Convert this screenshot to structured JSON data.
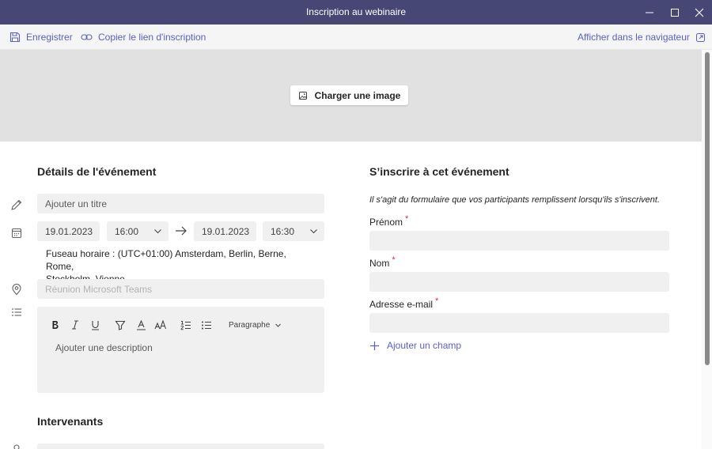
{
  "window": {
    "title": "Inscription au webinaire"
  },
  "toolbar": {
    "save_label": "Enregistrer",
    "copy_link_label": "Copier le lien d'inscription",
    "open_browser_label": "Afficher dans le navigateur"
  },
  "banner": {
    "upload_label": "Charger une image"
  },
  "details": {
    "heading": "Détails de l'événement",
    "title_placeholder": "Ajouter un titre",
    "start_date": "19.01.2023",
    "start_time": "16:00",
    "end_date": "19.01.2023",
    "end_time": "16:30",
    "timezone_line1": "Fuseau horaire : (UTC+01:00) Amsterdam, Berlin, Berne, Rome,",
    "timezone_line2": "Stockholm, Vienne",
    "location_placeholder": "Réunion Microsoft Teams",
    "editor": {
      "paragraph_label": "Paragraphe",
      "description_placeholder": "Ajouter une description"
    }
  },
  "speakers": {
    "heading": "Intervenants"
  },
  "registration": {
    "heading": "S’inscrire à cet événement",
    "intro": "Il s'agit du formulaire que vos participants remplissent lorsqu'ils s'inscrivent.",
    "fields": [
      {
        "label": "Prénom",
        "required_mark": "*"
      },
      {
        "label": "Nom",
        "required_mark": "*"
      },
      {
        "label": "Adresse e-mail",
        "required_mark": "*"
      }
    ],
    "add_field_label": "Ajouter un champ"
  },
  "colors": {
    "titlebar": "#464775",
    "accent": "#5b5fc7",
    "required": "#c4314b",
    "field_bg": "#f0f0f0",
    "banner_bg": "#e1e1e1"
  }
}
